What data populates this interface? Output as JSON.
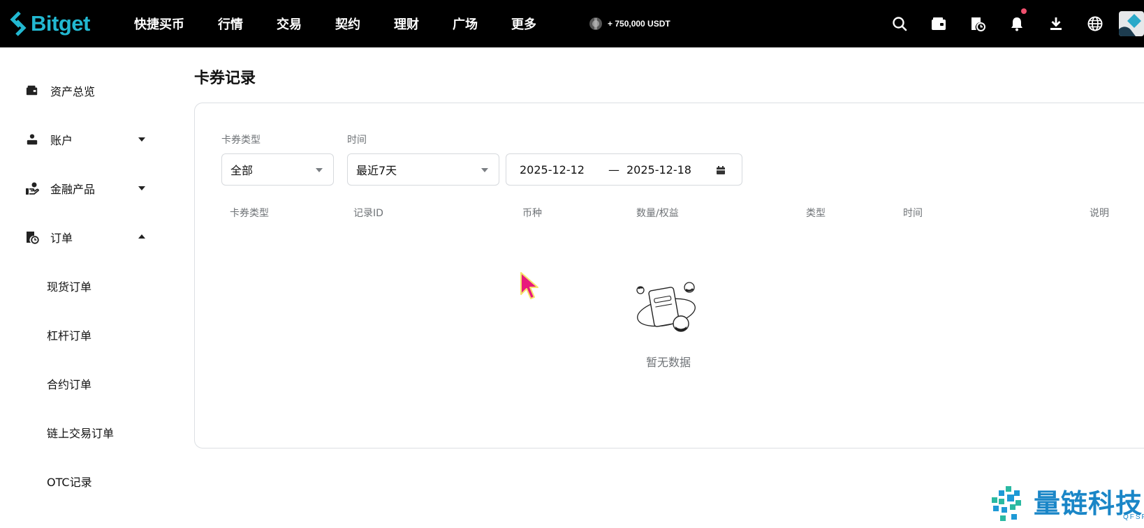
{
  "brand": {
    "name": "Bitget",
    "color": "#22b8d1"
  },
  "nav": [
    "快捷买币",
    "行情",
    "交易",
    "契约",
    "理财",
    "广场",
    "更多"
  ],
  "promo": {
    "text": "+ 750,000 USDT"
  },
  "top_icons": [
    "search-icon",
    "wallet-icon",
    "order-clock-icon",
    "bell-icon",
    "download-icon",
    "globe-icon",
    "avatar"
  ],
  "sidebar": {
    "items": [
      {
        "label": "资产总览",
        "icon": "wallet-icon"
      },
      {
        "label": "账户",
        "icon": "user-icon",
        "caret": "down"
      },
      {
        "label": "金融产品",
        "icon": "finance-icon",
        "caret": "down"
      },
      {
        "label": "订单",
        "icon": "order-clock-icon",
        "caret": "up"
      }
    ],
    "sub_items": [
      "现货订单",
      "杠杆订单",
      "合约订单",
      "链上交易订单",
      "OTC记录"
    ]
  },
  "page": {
    "title": "卡券记录"
  },
  "filters": {
    "type_label": "卡券类型",
    "type_value": "全部",
    "time_label": "时间",
    "time_value": "最近7天",
    "date_start": "2025-12-12",
    "date_sep": "—",
    "date_end": "2025-12-18"
  },
  "table": {
    "columns": [
      "卡券类型",
      "记录ID",
      "币种",
      "数量/权益",
      "类型",
      "时间",
      "说明"
    ],
    "rows": []
  },
  "empty": {
    "text": "暂无数据"
  },
  "watermark": {
    "text": "量链科技",
    "sub": "QFSP.NET"
  }
}
